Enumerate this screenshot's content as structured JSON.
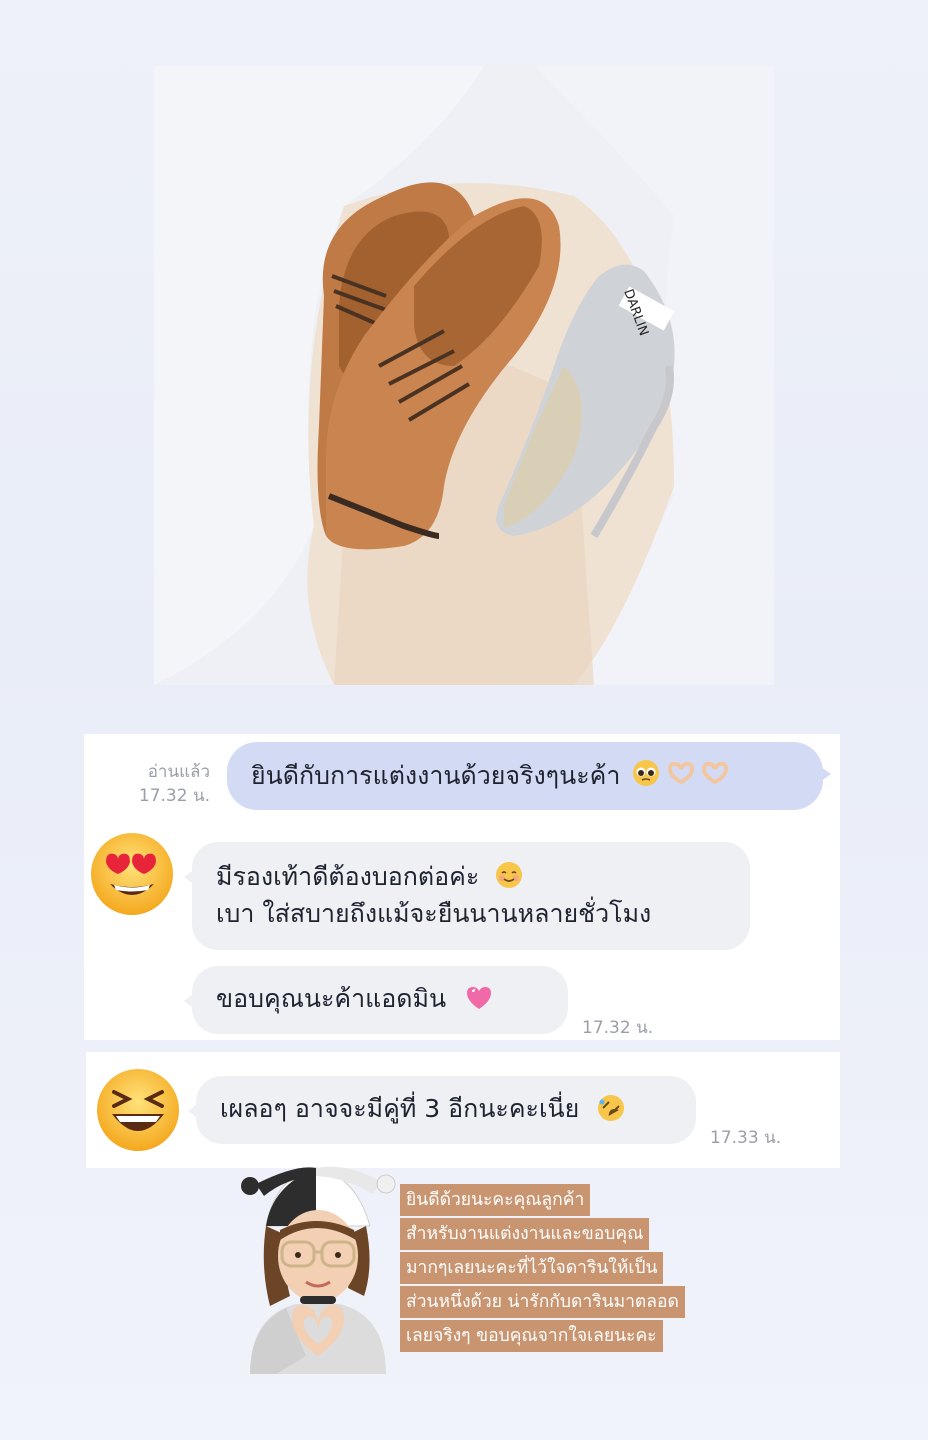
{
  "photo": {
    "shoe_brand_text": "DARLIN"
  },
  "chat1": {
    "read_label": "อ่านแล้ว",
    "read_time": "17.32 น.",
    "out_message": "ยินดีกับการแต่งงานด้วยจริงๆนะค้า",
    "in_message_line1": "มีรองเท้าดีต้องบอกต่อค่ะ",
    "in_message_line2": "เบา ใส่สบายถึงแม้จะยืนนานหลายชั่วโมง",
    "in_message2": "ขอบคุณนะค้าแอดมิน",
    "in_time": "17.32 น."
  },
  "chat2": {
    "in_message": "เผลอๆ อาจจะมีคู่ที่ 3 อีกนะคะเนี่ย",
    "in_time": "17.33 น."
  },
  "caption": {
    "lines": [
      "ยินดีด้วยนะคะคุณลูกค้า",
      "สำหรับงานแต่งงานและขอบคุณ",
      "มากๆเลยนะคะที่ไว้ใจดารินให้เป็น",
      "ส่วนหนึ่งด้วย น่ารักกับดารินมาตลอด",
      "เลยจริงๆ ขอบคุณจากใจเลยนะคะ"
    ]
  },
  "colors": {
    "out_bubble": "#d3dbf4",
    "in_bubble": "#eef0f4",
    "caption_bg": "#c99470"
  },
  "icons": {
    "avatar1": "heart-eyes-emoji",
    "avatar2": "laughing-squint-emoji",
    "sticker": "memoji-heart-hands"
  }
}
